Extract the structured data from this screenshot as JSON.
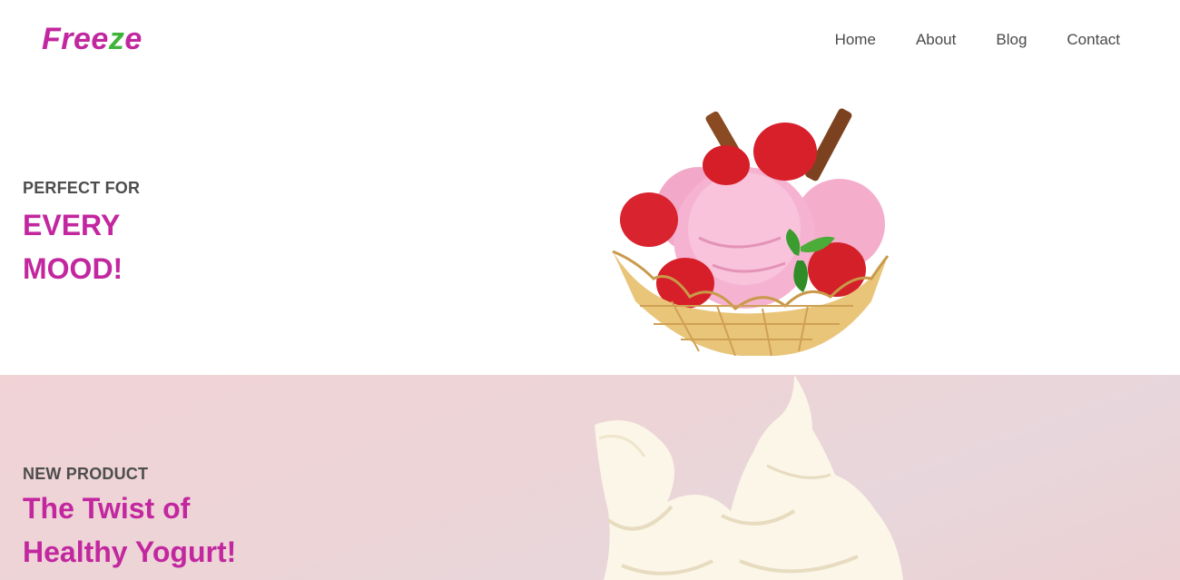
{
  "brand": {
    "part1": "Free",
    "part2": "z",
    "part3": "e",
    "color_main": "#c2279f",
    "color_accent": "#3db33a"
  },
  "nav": {
    "items": [
      "Home",
      "About",
      "Blog",
      "Contact"
    ]
  },
  "slides": [
    {
      "kicker": "PERFECT FOR",
      "line1": "EVERY",
      "line2": "MOOD!",
      "image": "strawberry-ice-cream-waffle-bowl"
    },
    {
      "kicker": "NEW PRODUCT",
      "line1": "The Twist of",
      "line2": "Healthy Yogurt!",
      "image": "frozen-yogurt-swirl"
    }
  ]
}
